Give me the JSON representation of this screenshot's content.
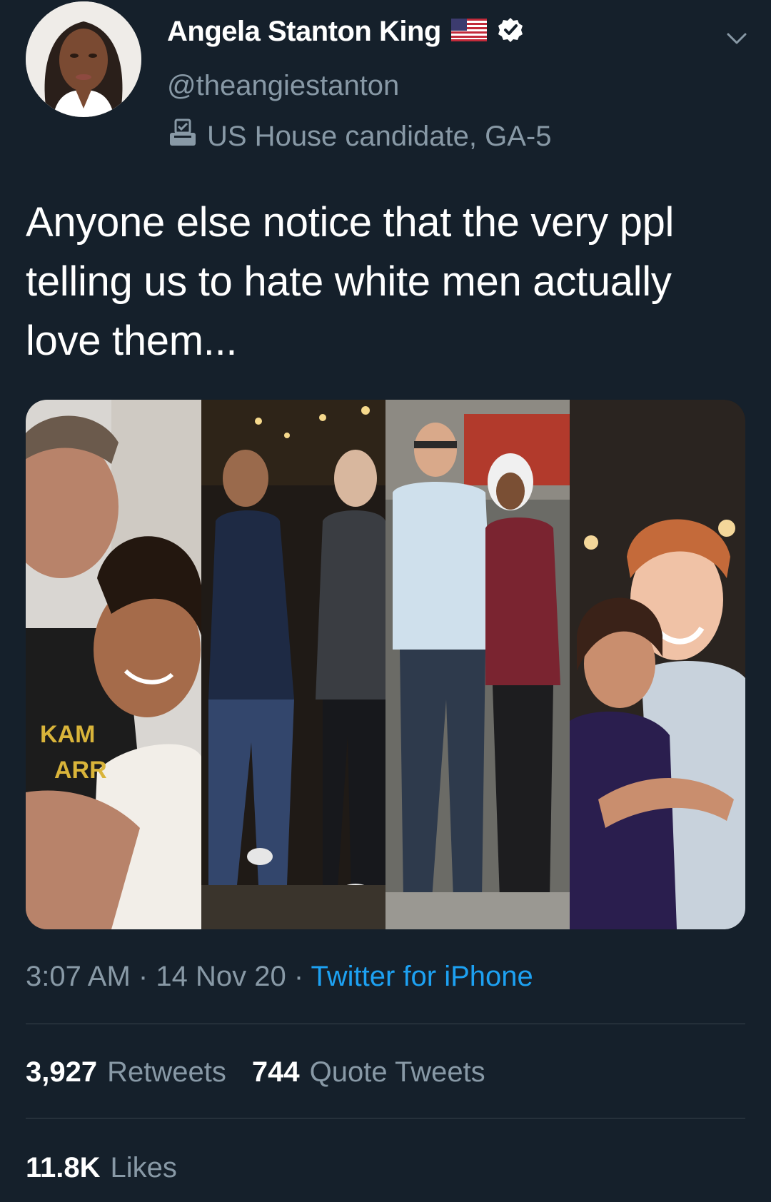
{
  "header": {
    "display_name": "Angela Stanton King",
    "handle": "@theangiestanton",
    "label": "US House candidate, GA-5",
    "flag_icon": "us-flag-icon",
    "verified_icon": "verified-badge-icon",
    "label_icon": "ballot-box-icon",
    "menu_icon": "chevron-down-icon"
  },
  "tweet": {
    "text": "Anyone else notice that the very ppl telling us to hate white men actually love them..."
  },
  "meta": {
    "time": "3:07 AM",
    "separator1": "·",
    "date": "14 Nov 20",
    "separator2": "·",
    "source": "Twitter for iPhone"
  },
  "stats": {
    "retweets_count": "3,927",
    "retweets_label": "Retweets",
    "quotes_count": "744",
    "quotes_label": "Quote Tweets",
    "likes_count": "11.8K",
    "likes_label": "Likes"
  },
  "colors": {
    "background": "#15202b",
    "secondary_text": "#8899a6",
    "link": "#1da1f2",
    "divider": "#38444d"
  }
}
